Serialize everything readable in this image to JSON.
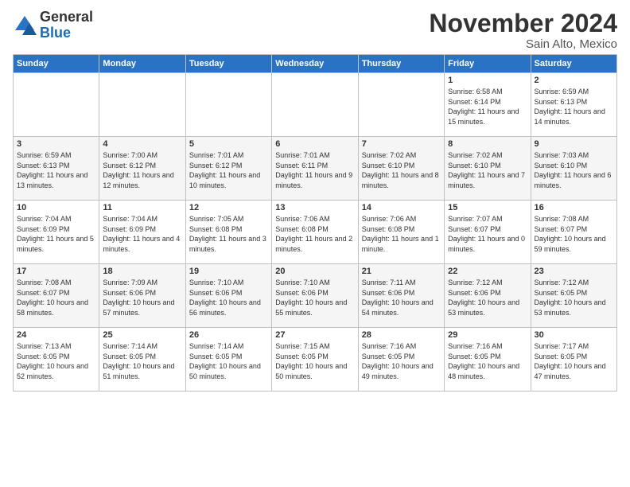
{
  "logo": {
    "line1": "General",
    "line2": "Blue"
  },
  "title": "November 2024",
  "subtitle": "Sain Alto, Mexico",
  "days_of_week": [
    "Sunday",
    "Monday",
    "Tuesday",
    "Wednesday",
    "Thursday",
    "Friday",
    "Saturday"
  ],
  "weeks": [
    [
      {
        "day": "",
        "content": ""
      },
      {
        "day": "",
        "content": ""
      },
      {
        "day": "",
        "content": ""
      },
      {
        "day": "",
        "content": ""
      },
      {
        "day": "",
        "content": ""
      },
      {
        "day": "1",
        "content": "Sunrise: 6:58 AM\nSunset: 6:14 PM\nDaylight: 11 hours and 15 minutes."
      },
      {
        "day": "2",
        "content": "Sunrise: 6:59 AM\nSunset: 6:13 PM\nDaylight: 11 hours and 14 minutes."
      }
    ],
    [
      {
        "day": "3",
        "content": "Sunrise: 6:59 AM\nSunset: 6:13 PM\nDaylight: 11 hours and 13 minutes."
      },
      {
        "day": "4",
        "content": "Sunrise: 7:00 AM\nSunset: 6:12 PM\nDaylight: 11 hours and 12 minutes."
      },
      {
        "day": "5",
        "content": "Sunrise: 7:01 AM\nSunset: 6:12 PM\nDaylight: 11 hours and 10 minutes."
      },
      {
        "day": "6",
        "content": "Sunrise: 7:01 AM\nSunset: 6:11 PM\nDaylight: 11 hours and 9 minutes."
      },
      {
        "day": "7",
        "content": "Sunrise: 7:02 AM\nSunset: 6:10 PM\nDaylight: 11 hours and 8 minutes."
      },
      {
        "day": "8",
        "content": "Sunrise: 7:02 AM\nSunset: 6:10 PM\nDaylight: 11 hours and 7 minutes."
      },
      {
        "day": "9",
        "content": "Sunrise: 7:03 AM\nSunset: 6:10 PM\nDaylight: 11 hours and 6 minutes."
      }
    ],
    [
      {
        "day": "10",
        "content": "Sunrise: 7:04 AM\nSunset: 6:09 PM\nDaylight: 11 hours and 5 minutes."
      },
      {
        "day": "11",
        "content": "Sunrise: 7:04 AM\nSunset: 6:09 PM\nDaylight: 11 hours and 4 minutes."
      },
      {
        "day": "12",
        "content": "Sunrise: 7:05 AM\nSunset: 6:08 PM\nDaylight: 11 hours and 3 minutes."
      },
      {
        "day": "13",
        "content": "Sunrise: 7:06 AM\nSunset: 6:08 PM\nDaylight: 11 hours and 2 minutes."
      },
      {
        "day": "14",
        "content": "Sunrise: 7:06 AM\nSunset: 6:08 PM\nDaylight: 11 hours and 1 minute."
      },
      {
        "day": "15",
        "content": "Sunrise: 7:07 AM\nSunset: 6:07 PM\nDaylight: 11 hours and 0 minutes."
      },
      {
        "day": "16",
        "content": "Sunrise: 7:08 AM\nSunset: 6:07 PM\nDaylight: 10 hours and 59 minutes."
      }
    ],
    [
      {
        "day": "17",
        "content": "Sunrise: 7:08 AM\nSunset: 6:07 PM\nDaylight: 10 hours and 58 minutes."
      },
      {
        "day": "18",
        "content": "Sunrise: 7:09 AM\nSunset: 6:06 PM\nDaylight: 10 hours and 57 minutes."
      },
      {
        "day": "19",
        "content": "Sunrise: 7:10 AM\nSunset: 6:06 PM\nDaylight: 10 hours and 56 minutes."
      },
      {
        "day": "20",
        "content": "Sunrise: 7:10 AM\nSunset: 6:06 PM\nDaylight: 10 hours and 55 minutes."
      },
      {
        "day": "21",
        "content": "Sunrise: 7:11 AM\nSunset: 6:06 PM\nDaylight: 10 hours and 54 minutes."
      },
      {
        "day": "22",
        "content": "Sunrise: 7:12 AM\nSunset: 6:06 PM\nDaylight: 10 hours and 53 minutes."
      },
      {
        "day": "23",
        "content": "Sunrise: 7:12 AM\nSunset: 6:05 PM\nDaylight: 10 hours and 53 minutes."
      }
    ],
    [
      {
        "day": "24",
        "content": "Sunrise: 7:13 AM\nSunset: 6:05 PM\nDaylight: 10 hours and 52 minutes."
      },
      {
        "day": "25",
        "content": "Sunrise: 7:14 AM\nSunset: 6:05 PM\nDaylight: 10 hours and 51 minutes."
      },
      {
        "day": "26",
        "content": "Sunrise: 7:14 AM\nSunset: 6:05 PM\nDaylight: 10 hours and 50 minutes."
      },
      {
        "day": "27",
        "content": "Sunrise: 7:15 AM\nSunset: 6:05 PM\nDaylight: 10 hours and 50 minutes."
      },
      {
        "day": "28",
        "content": "Sunrise: 7:16 AM\nSunset: 6:05 PM\nDaylight: 10 hours and 49 minutes."
      },
      {
        "day": "29",
        "content": "Sunrise: 7:16 AM\nSunset: 6:05 PM\nDaylight: 10 hours and 48 minutes."
      },
      {
        "day": "30",
        "content": "Sunrise: 7:17 AM\nSunset: 6:05 PM\nDaylight: 10 hours and 47 minutes."
      }
    ]
  ]
}
